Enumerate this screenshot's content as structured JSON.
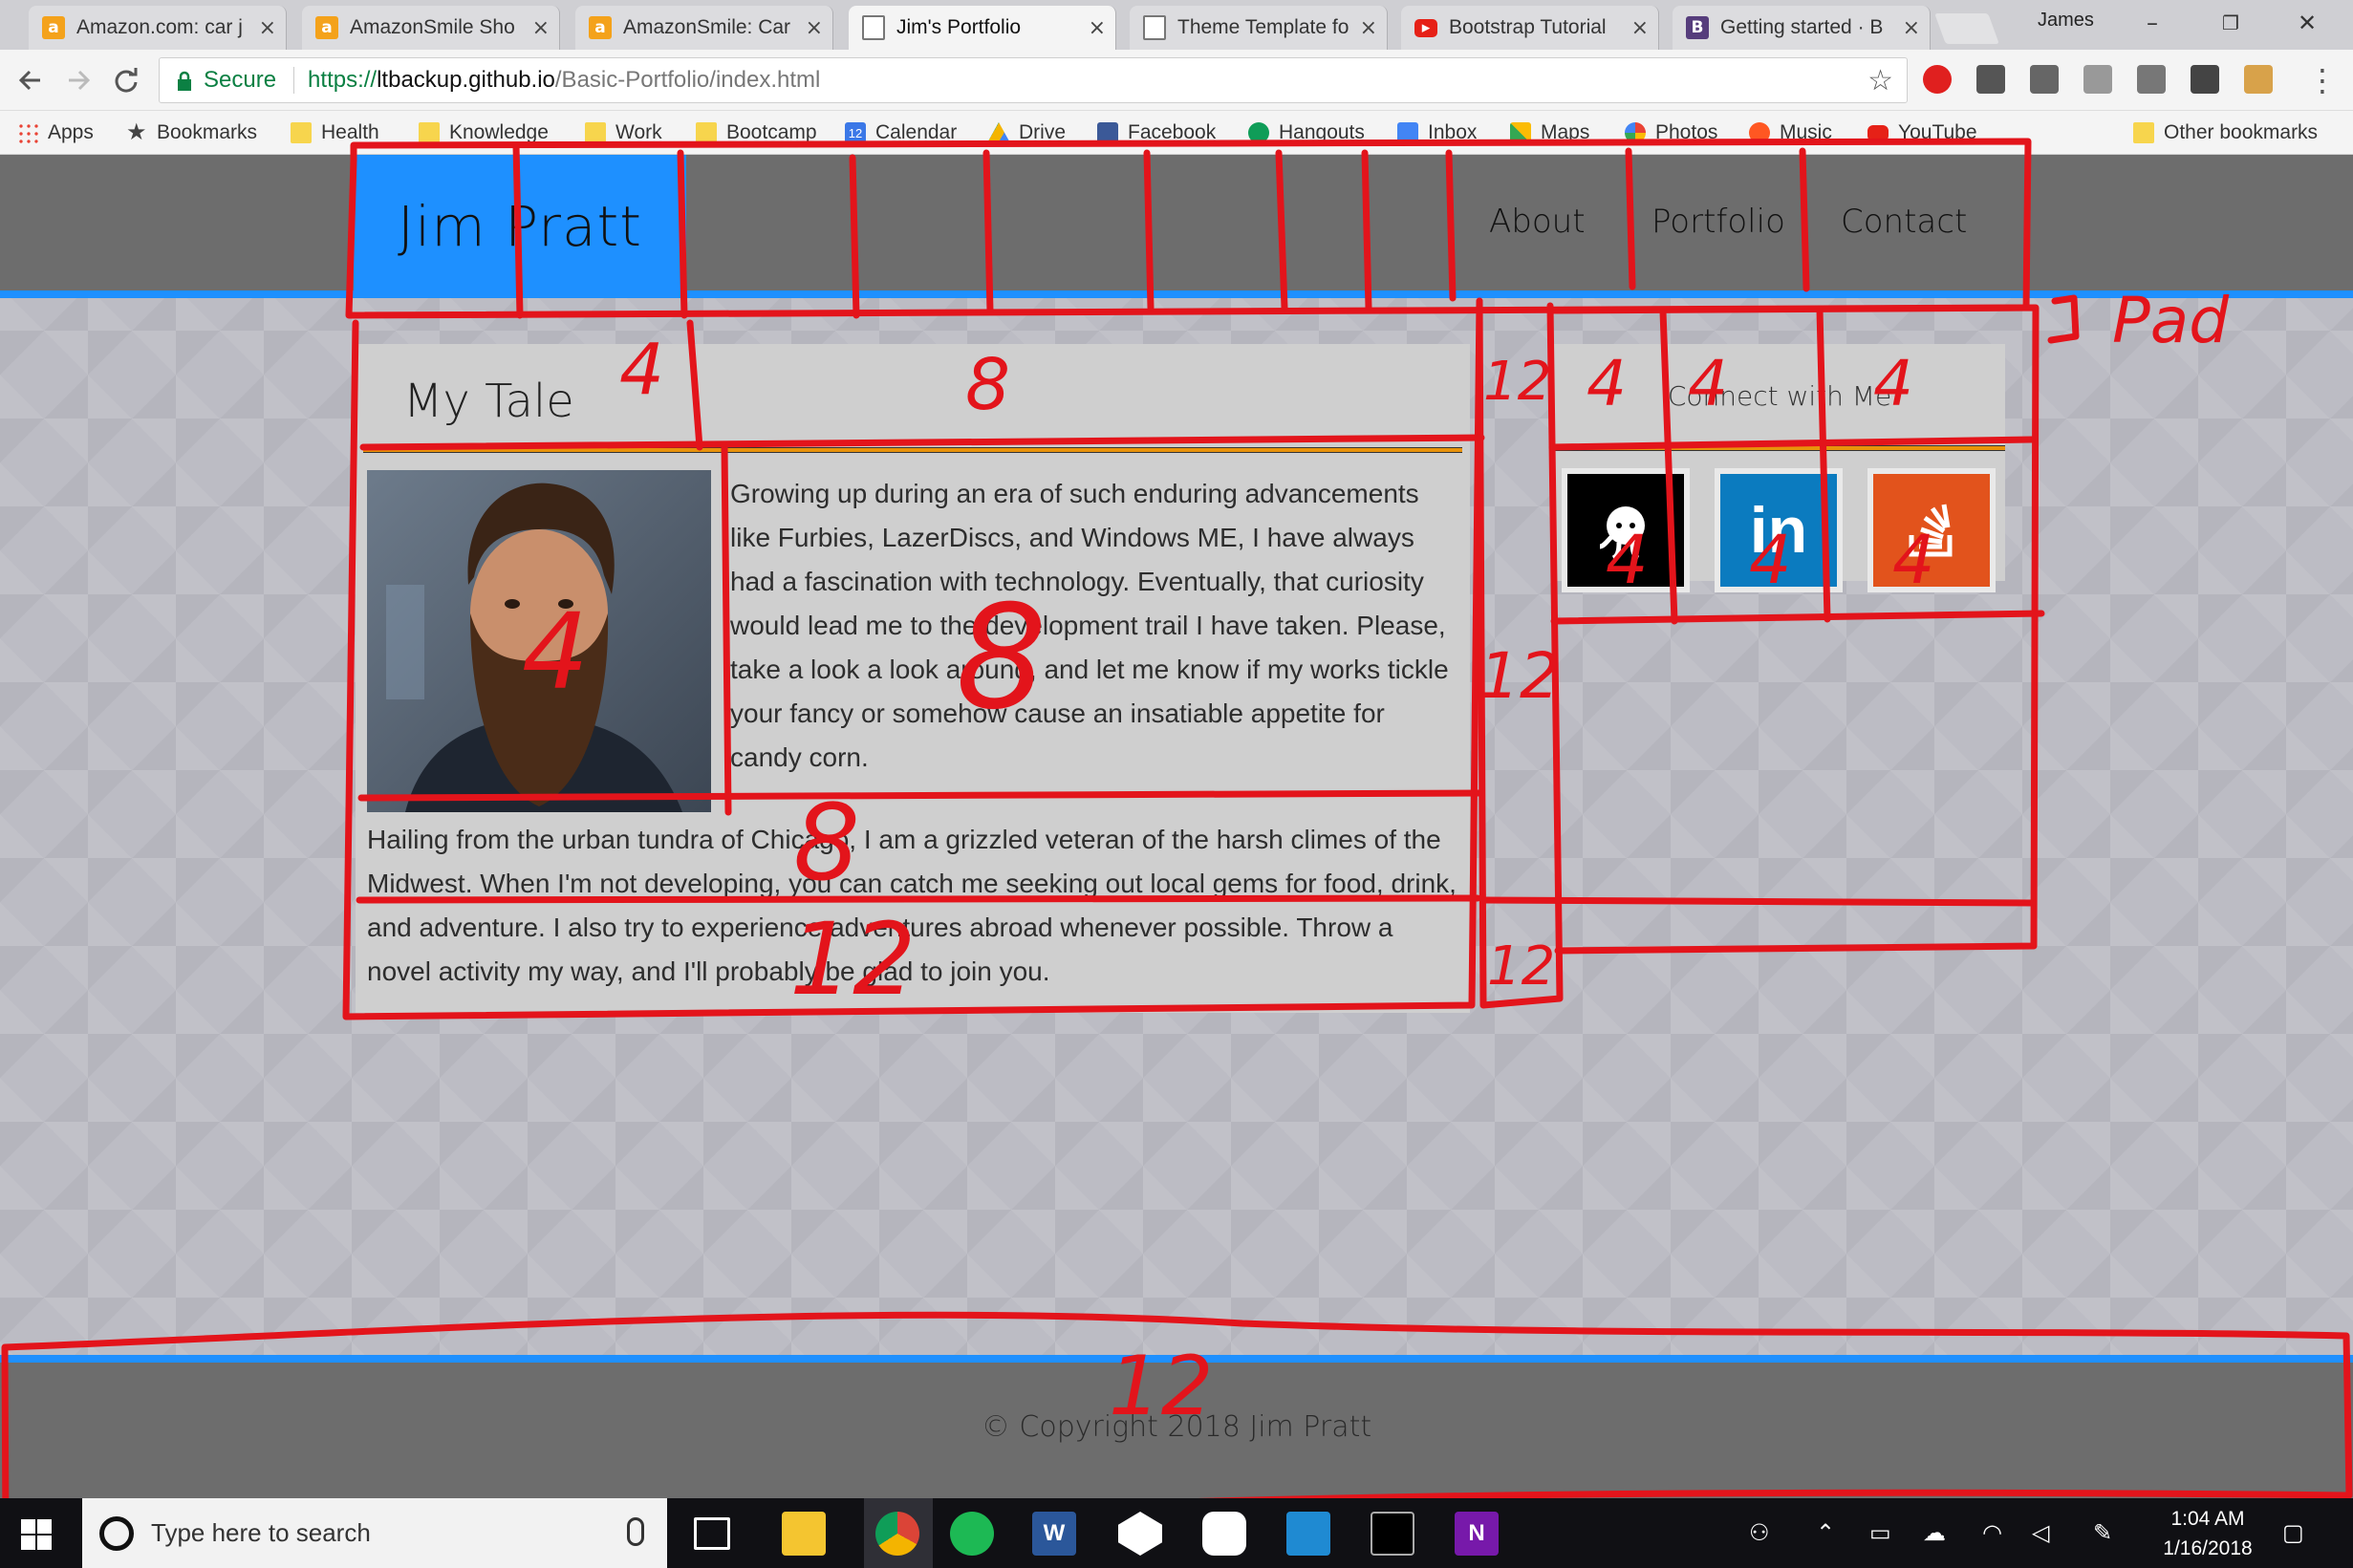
{
  "browser": {
    "tabs": [
      {
        "title": "Amazon.com: car j",
        "icon": "amazon-icon",
        "active": false
      },
      {
        "title": "AmazonSmile Sho",
        "icon": "amazon-icon",
        "active": false
      },
      {
        "title": "AmazonSmile: Car",
        "icon": "amazon-icon",
        "active": false
      },
      {
        "title": "Jim's Portfolio",
        "icon": "page-icon",
        "active": true
      },
      {
        "title": "Theme Template fo",
        "icon": "page-icon",
        "active": false
      },
      {
        "title": "Bootstrap Tutorial",
        "icon": "youtube-icon",
        "active": false
      },
      {
        "title": "Getting started · B",
        "icon": "bootstrap-icon",
        "active": false
      }
    ],
    "tab_close": "×",
    "profile_name": "James",
    "window_controls": {
      "minimize": "–",
      "restore": "❐",
      "close": "✕"
    },
    "secure_label": "Secure",
    "url": {
      "scheme": "https://",
      "host": "ltbackup.github.io",
      "path": "/Basic-Portfolio/index.html"
    },
    "bookmark_star": "☆",
    "bookmarks": [
      {
        "label": "Apps",
        "icon": "apps-grid-icon"
      },
      {
        "label": "Bookmarks",
        "icon": "star-icon"
      },
      {
        "label": "Health",
        "icon": "folder-icon"
      },
      {
        "label": "Knowledge",
        "icon": "folder-icon"
      },
      {
        "label": "Work",
        "icon": "folder-icon"
      },
      {
        "label": "Bootcamp",
        "icon": "folder-icon"
      },
      {
        "label": "Calendar",
        "icon": "calendar-icon"
      },
      {
        "label": "Drive",
        "icon": "drive-icon"
      },
      {
        "label": "Facebook",
        "icon": "facebook-icon"
      },
      {
        "label": "Hangouts",
        "icon": "hangouts-icon"
      },
      {
        "label": "Inbox",
        "icon": "inbox-icon"
      },
      {
        "label": "Maps",
        "icon": "maps-icon"
      },
      {
        "label": "Photos",
        "icon": "photos-icon"
      },
      {
        "label": "Music",
        "icon": "music-icon"
      },
      {
        "label": "YouTube",
        "icon": "youtube-icon"
      }
    ],
    "calendar_day": "12",
    "other_bookmarks": "Other bookmarks"
  },
  "site": {
    "brand": "Jim Pratt",
    "nav": [
      "About",
      "Portfolio",
      "Contact"
    ],
    "tale": {
      "title": "My Tale",
      "paragraph1": "Growing up during an era of such enduring advancements like Furbies, LazerDiscs, and Windows ME, I have always had a fascination with technology. Eventually, that curiosity would lead me to the development trail I have taken. Please, take a look a look around, and let me know if my works tickle your fancy or somehow cause an insatiable appetite for candy corn.",
      "paragraph2": "Hailing from the urban tundra of Chicago, I am a grizzled veteran of the harsh climes of the Midwest. When I'm not developing, you can catch me seeking out local gems for food, drink, and adventure. I also try to experience adventures abroad whenever possible. Throw a novel activity my way, and I'll probably be glad to join you."
    },
    "connect": {
      "title": "Connect with Me",
      "links": [
        {
          "name": "github",
          "icon": "github-icon",
          "color": "#000000"
        },
        {
          "name": "linkedin",
          "icon": "linkedin-icon",
          "color": "#0b7bbf",
          "label": "in"
        },
        {
          "name": "stackoverflow",
          "icon": "stackoverflow-icon",
          "color": "#e2531c"
        }
      ]
    },
    "footer": "© Copyright 2018 Jim Pratt",
    "colors": {
      "accent_blue": "#1e90ff",
      "rule_orange": "#e8930b",
      "header_gray": "#6d6d6d"
    }
  },
  "annotations": {
    "color": "#e3141b",
    "labels": [
      "4",
      "8",
      "12",
      "4",
      "4",
      "4",
      "Pad",
      "4",
      "8",
      "8",
      "12",
      "12",
      "12",
      "4",
      "4",
      "4",
      "12"
    ]
  },
  "taskbar": {
    "search_placeholder": "Type here to search",
    "apps": [
      "task-view-icon",
      "file-explorer-icon",
      "chrome-icon",
      "spotify-icon",
      "word-icon",
      "unity-icon",
      "slack-icon",
      "vscode-icon",
      "terminal-icon",
      "onenote-icon"
    ],
    "word_letter": "W",
    "onenote_letter": "N",
    "time": "1:04 AM",
    "date": "1/16/2018"
  }
}
